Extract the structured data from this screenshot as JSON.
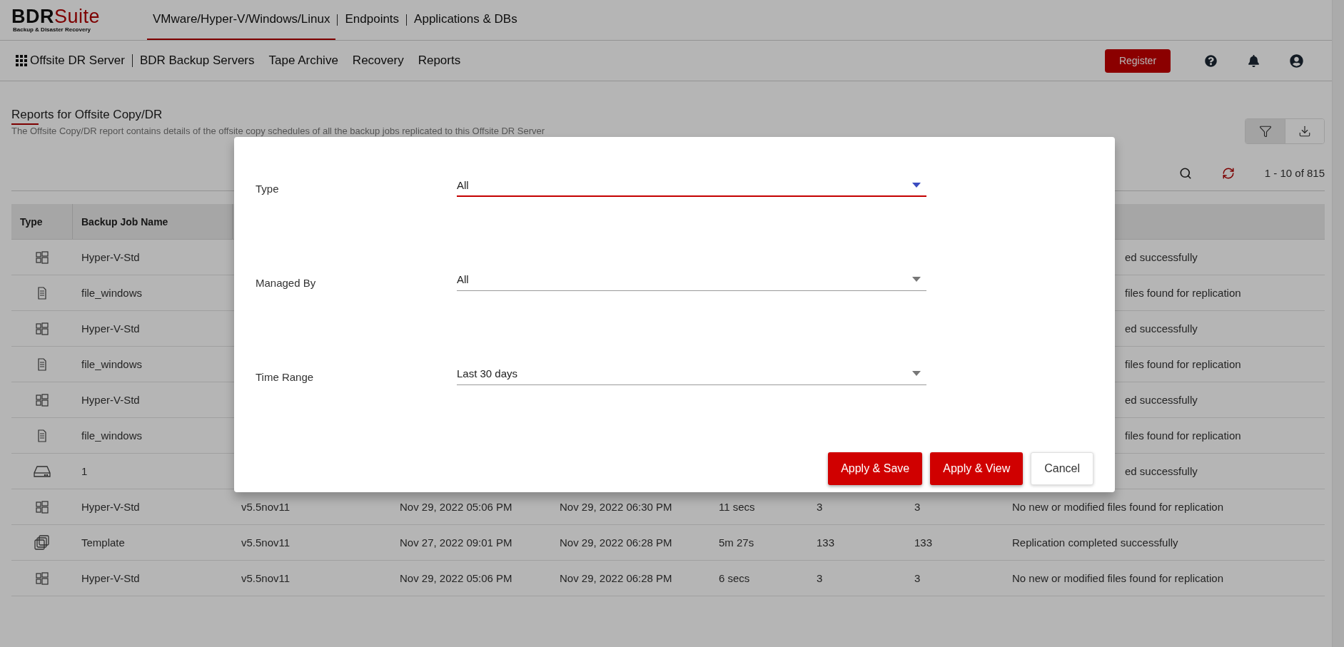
{
  "logo": {
    "primary": "BDR",
    "accent": "Suite",
    "tagline": "Backup & Disaster Recovery"
  },
  "product_tabs": [
    {
      "label": "VMware/Hyper-V/Windows/Linux",
      "selected": true
    },
    {
      "label": "Endpoints",
      "selected": false
    },
    {
      "label": "Applications & DBs",
      "selected": false
    }
  ],
  "nav": {
    "home": "Offsite DR Server",
    "items": [
      "BDR Backup Servers",
      "Tape Archive",
      "Recovery",
      "Reports"
    ]
  },
  "header_actions": {
    "register": "Register"
  },
  "page": {
    "title": "Reports for Offsite Copy/DR",
    "description": "The Offsite Copy/DR report contains details of the offsite copy schedules of all the backup jobs replicated to this Offsite DR Server"
  },
  "view_buttons": [
    {
      "kind": "filter",
      "selected": true
    },
    {
      "kind": "download",
      "selected": false
    }
  ],
  "table_toolbar": {
    "count": "1 - 10 of 815"
  },
  "table": {
    "columns": [
      "Type",
      "Backup Job Name"
    ],
    "rows": [
      {
        "kind": "hyperv",
        "name": "Hyper-V-Std",
        "status": "ed successfully"
      },
      {
        "kind": "file",
        "name": "file_windows",
        "status": "files found for replication"
      },
      {
        "kind": "hyperv",
        "name": "Hyper-V-Std",
        "status": "ed successfully"
      },
      {
        "kind": "file",
        "name": "file_windows",
        "status": "files found for replication"
      },
      {
        "kind": "hyperv",
        "name": "Hyper-V-Std",
        "status": "ed successfully"
      },
      {
        "kind": "file",
        "name": "file_windows",
        "status": "files found for replication"
      },
      {
        "kind": "disk",
        "name": "1",
        "status": "ed successfully"
      },
      {
        "kind": "hyperv",
        "name": "Hyper-V-Std",
        "version": "v5.5nov11",
        "start": "Nov 29, 2022 05:06 PM",
        "end": "Nov 29, 2022 06:30 PM",
        "duration": "11 secs",
        "column_7": "3",
        "column_8": "3",
        "status": "No new or modified files found for replication"
      },
      {
        "kind": "template",
        "name": "Template",
        "version": "v5.5nov11",
        "start": "Nov 27, 2022 09:01 PM",
        "end": "Nov 29, 2022 06:28 PM",
        "duration": "5m 27s",
        "column_7": "133",
        "column_8": "133",
        "status": "Replication completed successfully"
      },
      {
        "kind": "hyperv",
        "name": "Hyper-V-Std",
        "version": "v5.5nov11",
        "start": "Nov 29, 2022 05:06 PM",
        "end": "Nov 29, 2022 06:28 PM",
        "duration": "6 secs",
        "column_7": "3",
        "column_8": "3",
        "status": "No new or modified files found for replication"
      }
    ]
  },
  "dialog": {
    "fields": [
      {
        "label": "Type",
        "value": "All",
        "focused": true
      },
      {
        "label": "Managed By",
        "value": "All",
        "focused": false
      },
      {
        "label": "Time Range",
        "value": "Last 30 days",
        "focused": false
      }
    ],
    "buttons": [
      {
        "label": "Apply & Save",
        "kind": "primary"
      },
      {
        "label": "Apply & View",
        "kind": "primary"
      },
      {
        "label": "Cancel",
        "kind": "secondary"
      }
    ]
  }
}
